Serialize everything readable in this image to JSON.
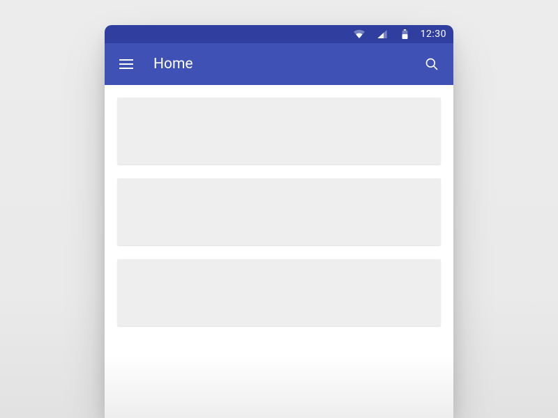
{
  "statusbar": {
    "time": "12:30"
  },
  "appbar": {
    "title": "Home"
  },
  "colors": {
    "primary": "#3f51b5",
    "primary_dark": "#303f9f",
    "card_bg": "#eeeeee",
    "page_bg": "#ececec"
  },
  "content": {
    "card_count": 3
  }
}
